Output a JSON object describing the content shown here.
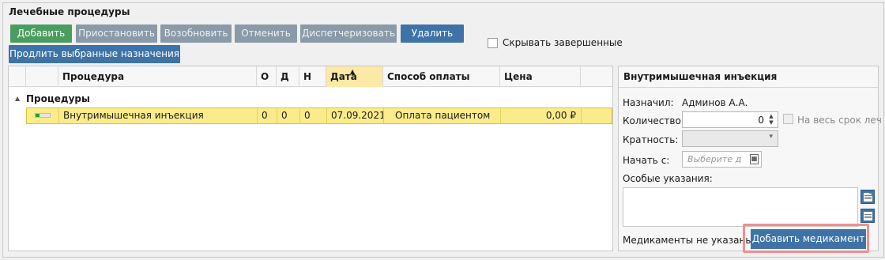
{
  "title": "Лечебные процедуры",
  "toolbar": {
    "add": "Добавить",
    "suspend": "Приостановить",
    "resume": "Возобновить",
    "cancel": "Отменить",
    "dispatch": "Диспетчеризовать",
    "delete": "Удалить",
    "extend": "Продлить выбранные назначения"
  },
  "hide_completed": {
    "label": "Скрывать завершенные",
    "checked": false
  },
  "grid": {
    "columns": [
      "Процедура",
      "О",
      "Д",
      "Н",
      "Дата",
      "Способ оплаты",
      "Цена"
    ],
    "group": "Процедуры",
    "rows": [
      {
        "procedure": "Внутримышечная инъекция",
        "o": "0",
        "d": "0",
        "n": "0",
        "date": "07.09.2021",
        "payment": "Оплата пациентом",
        "price": "0,00 ₽",
        "progress": 0.3
      }
    ]
  },
  "detail": {
    "title": "Внутримышечная инъекция",
    "prescribed_label": "Назначил:",
    "prescribed_value": "Админов А.А.",
    "quantity_label": "Количество:",
    "quantity_value": "0",
    "whole_term_label": "На весь срок леч",
    "multiplicity_label": "Кратность:",
    "start_label": "Начать с:",
    "start_placeholder": "Выберите д",
    "instructions_label": "Особые указания:",
    "no_meds": "Медикаменты не указаны",
    "add_med": "Добавить медикамент"
  }
}
